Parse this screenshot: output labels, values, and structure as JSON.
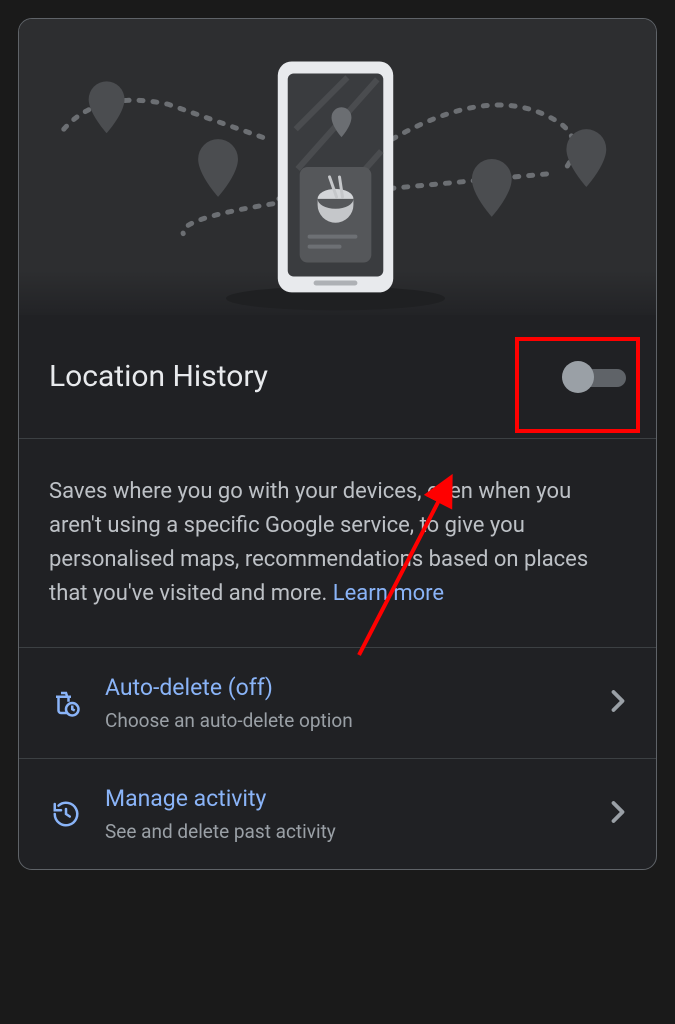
{
  "colors": {
    "accent": "#8ab4f8",
    "highlight": "#ff0000",
    "text_primary": "#e8eaed",
    "text_secondary": "#bdc1c6",
    "text_muted": "#9aa0a6"
  },
  "toggle": {
    "title": "Location History",
    "state": "off"
  },
  "description": {
    "text": "Saves where you go with your devices, even when you aren't using a specific Google service, to give you personalised maps, recommendations based on places that you've visited and more. ",
    "link_text": "Learn more"
  },
  "items": [
    {
      "icon": "auto-delete-icon",
      "title": "Auto-delete (off)",
      "subtitle": "Choose an auto-delete option"
    },
    {
      "icon": "history-icon",
      "title": "Manage activity",
      "subtitle": "See and delete past activity"
    }
  ]
}
